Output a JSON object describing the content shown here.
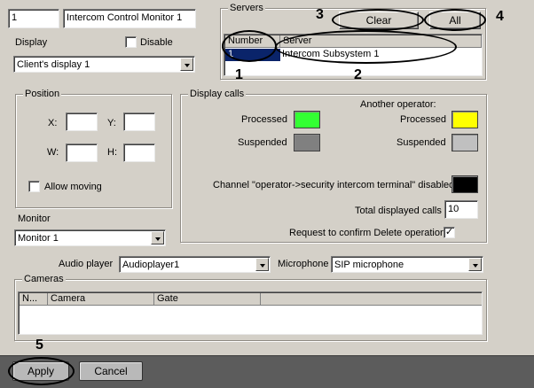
{
  "header": {
    "id_value": "1",
    "name_value": "Intercom Control Monitor 1",
    "display_label": "Display",
    "disable_label": "Disable",
    "disable_checked": false,
    "display_value": "Client's display 1"
  },
  "servers": {
    "legend": "Servers",
    "clear_label": "Clear",
    "all_label": "All",
    "columns": [
      "Number",
      "Server"
    ],
    "rows": [
      {
        "number": "1",
        "server": "Intercom Subsystem 1"
      }
    ]
  },
  "position": {
    "legend": "Position",
    "x_label": "X:",
    "y_label": "Y:",
    "w_label": "W:",
    "h_label": "H:",
    "x_value": "",
    "y_value": "",
    "w_value": "",
    "h_value": "",
    "allow_moving_label": "Allow moving",
    "allow_moving_checked": false
  },
  "monitor": {
    "label": "Monitor",
    "value": "Monitor 1"
  },
  "display_calls": {
    "legend": "Display calls",
    "another_operator_label": "Another operator:",
    "processed_label": "Processed",
    "suspended_label": "Suspended",
    "another_processed_label": "Processed",
    "another_suspended_label": "Suspended",
    "colors": {
      "processed": "#33ff33",
      "suspended": "#808080",
      "another_processed": "#ffff00",
      "another_suspended": "#c0c0c0",
      "channel_disabled": "#000000"
    },
    "channel_label": "Channel \"operator->security intercom terminal\" disabled",
    "total_label": "Total displayed calls",
    "total_value": "10",
    "request_label": "Request to confirm Delete operation",
    "request_checked": true
  },
  "audio": {
    "audio_player_label": "Audio player",
    "audio_player_value": "Audioplayer1",
    "microphone_label": "Microphone",
    "microphone_value": "SIP microphone"
  },
  "cameras": {
    "legend": "Cameras",
    "columns": [
      "N...",
      "Camera",
      "Gate"
    ]
  },
  "annotations": {
    "m1": "1",
    "m2": "2",
    "m3": "3",
    "m4": "4",
    "m5": "5"
  },
  "footer": {
    "apply_label": "Apply",
    "cancel_label": "Cancel"
  }
}
